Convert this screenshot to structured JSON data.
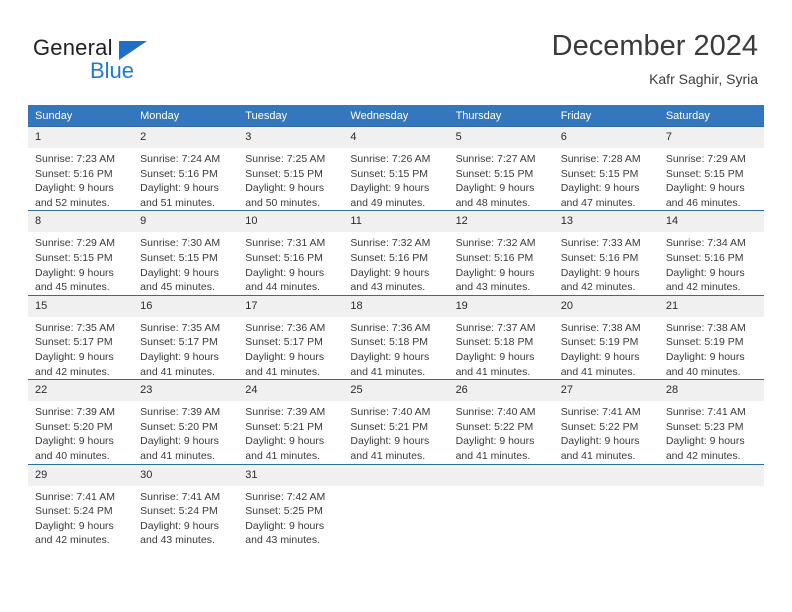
{
  "brand": {
    "name_top": "General",
    "name_bottom": "Blue",
    "accent_color": "#1f7ad4",
    "triangle_color": "#1f6fc4"
  },
  "header": {
    "month_title": "December 2024",
    "location": "Kafr Saghir, Syria"
  },
  "theme": {
    "header_row_bg": "#3577bc",
    "cell_border": "#2d6ca8",
    "daynum_bg": "#f0f0f0",
    "text": "#3a3a3a"
  },
  "weekday_headers": [
    "Sunday",
    "Monday",
    "Tuesday",
    "Wednesday",
    "Thursday",
    "Friday",
    "Saturday"
  ],
  "weeks": [
    [
      {
        "day": "1",
        "sunrise": "Sunrise: 7:23 AM",
        "sunset": "Sunset: 5:16 PM",
        "daylight_1": "Daylight: 9 hours",
        "daylight_2": "and 52 minutes."
      },
      {
        "day": "2",
        "sunrise": "Sunrise: 7:24 AM",
        "sunset": "Sunset: 5:16 PM",
        "daylight_1": "Daylight: 9 hours",
        "daylight_2": "and 51 minutes."
      },
      {
        "day": "3",
        "sunrise": "Sunrise: 7:25 AM",
        "sunset": "Sunset: 5:15 PM",
        "daylight_1": "Daylight: 9 hours",
        "daylight_2": "and 50 minutes."
      },
      {
        "day": "4",
        "sunrise": "Sunrise: 7:26 AM",
        "sunset": "Sunset: 5:15 PM",
        "daylight_1": "Daylight: 9 hours",
        "daylight_2": "and 49 minutes."
      },
      {
        "day": "5",
        "sunrise": "Sunrise: 7:27 AM",
        "sunset": "Sunset: 5:15 PM",
        "daylight_1": "Daylight: 9 hours",
        "daylight_2": "and 48 minutes."
      },
      {
        "day": "6",
        "sunrise": "Sunrise: 7:28 AM",
        "sunset": "Sunset: 5:15 PM",
        "daylight_1": "Daylight: 9 hours",
        "daylight_2": "and 47 minutes."
      },
      {
        "day": "7",
        "sunrise": "Sunrise: 7:29 AM",
        "sunset": "Sunset: 5:15 PM",
        "daylight_1": "Daylight: 9 hours",
        "daylight_2": "and 46 minutes."
      }
    ],
    [
      {
        "day": "8",
        "sunrise": "Sunrise: 7:29 AM",
        "sunset": "Sunset: 5:15 PM",
        "daylight_1": "Daylight: 9 hours",
        "daylight_2": "and 45 minutes."
      },
      {
        "day": "9",
        "sunrise": "Sunrise: 7:30 AM",
        "sunset": "Sunset: 5:15 PM",
        "daylight_1": "Daylight: 9 hours",
        "daylight_2": "and 45 minutes."
      },
      {
        "day": "10",
        "sunrise": "Sunrise: 7:31 AM",
        "sunset": "Sunset: 5:16 PM",
        "daylight_1": "Daylight: 9 hours",
        "daylight_2": "and 44 minutes."
      },
      {
        "day": "11",
        "sunrise": "Sunrise: 7:32 AM",
        "sunset": "Sunset: 5:16 PM",
        "daylight_1": "Daylight: 9 hours",
        "daylight_2": "and 43 minutes."
      },
      {
        "day": "12",
        "sunrise": "Sunrise: 7:32 AM",
        "sunset": "Sunset: 5:16 PM",
        "daylight_1": "Daylight: 9 hours",
        "daylight_2": "and 43 minutes."
      },
      {
        "day": "13",
        "sunrise": "Sunrise: 7:33 AM",
        "sunset": "Sunset: 5:16 PM",
        "daylight_1": "Daylight: 9 hours",
        "daylight_2": "and 42 minutes."
      },
      {
        "day": "14",
        "sunrise": "Sunrise: 7:34 AM",
        "sunset": "Sunset: 5:16 PM",
        "daylight_1": "Daylight: 9 hours",
        "daylight_2": "and 42 minutes."
      }
    ],
    [
      {
        "day": "15",
        "sunrise": "Sunrise: 7:35 AM",
        "sunset": "Sunset: 5:17 PM",
        "daylight_1": "Daylight: 9 hours",
        "daylight_2": "and 42 minutes."
      },
      {
        "day": "16",
        "sunrise": "Sunrise: 7:35 AM",
        "sunset": "Sunset: 5:17 PM",
        "daylight_1": "Daylight: 9 hours",
        "daylight_2": "and 41 minutes."
      },
      {
        "day": "17",
        "sunrise": "Sunrise: 7:36 AM",
        "sunset": "Sunset: 5:17 PM",
        "daylight_1": "Daylight: 9 hours",
        "daylight_2": "and 41 minutes."
      },
      {
        "day": "18",
        "sunrise": "Sunrise: 7:36 AM",
        "sunset": "Sunset: 5:18 PM",
        "daylight_1": "Daylight: 9 hours",
        "daylight_2": "and 41 minutes."
      },
      {
        "day": "19",
        "sunrise": "Sunrise: 7:37 AM",
        "sunset": "Sunset: 5:18 PM",
        "daylight_1": "Daylight: 9 hours",
        "daylight_2": "and 41 minutes."
      },
      {
        "day": "20",
        "sunrise": "Sunrise: 7:38 AM",
        "sunset": "Sunset: 5:19 PM",
        "daylight_1": "Daylight: 9 hours",
        "daylight_2": "and 41 minutes."
      },
      {
        "day": "21",
        "sunrise": "Sunrise: 7:38 AM",
        "sunset": "Sunset: 5:19 PM",
        "daylight_1": "Daylight: 9 hours",
        "daylight_2": "and 40 minutes."
      }
    ],
    [
      {
        "day": "22",
        "sunrise": "Sunrise: 7:39 AM",
        "sunset": "Sunset: 5:20 PM",
        "daylight_1": "Daylight: 9 hours",
        "daylight_2": "and 40 minutes."
      },
      {
        "day": "23",
        "sunrise": "Sunrise: 7:39 AM",
        "sunset": "Sunset: 5:20 PM",
        "daylight_1": "Daylight: 9 hours",
        "daylight_2": "and 41 minutes."
      },
      {
        "day": "24",
        "sunrise": "Sunrise: 7:39 AM",
        "sunset": "Sunset: 5:21 PM",
        "daylight_1": "Daylight: 9 hours",
        "daylight_2": "and 41 minutes."
      },
      {
        "day": "25",
        "sunrise": "Sunrise: 7:40 AM",
        "sunset": "Sunset: 5:21 PM",
        "daylight_1": "Daylight: 9 hours",
        "daylight_2": "and 41 minutes."
      },
      {
        "day": "26",
        "sunrise": "Sunrise: 7:40 AM",
        "sunset": "Sunset: 5:22 PM",
        "daylight_1": "Daylight: 9 hours",
        "daylight_2": "and 41 minutes."
      },
      {
        "day": "27",
        "sunrise": "Sunrise: 7:41 AM",
        "sunset": "Sunset: 5:22 PM",
        "daylight_1": "Daylight: 9 hours",
        "daylight_2": "and 41 minutes."
      },
      {
        "day": "28",
        "sunrise": "Sunrise: 7:41 AM",
        "sunset": "Sunset: 5:23 PM",
        "daylight_1": "Daylight: 9 hours",
        "daylight_2": "and 42 minutes."
      }
    ],
    [
      {
        "day": "29",
        "sunrise": "Sunrise: 7:41 AM",
        "sunset": "Sunset: 5:24 PM",
        "daylight_1": "Daylight: 9 hours",
        "daylight_2": "and 42 minutes."
      },
      {
        "day": "30",
        "sunrise": "Sunrise: 7:41 AM",
        "sunset": "Sunset: 5:24 PM",
        "daylight_1": "Daylight: 9 hours",
        "daylight_2": "and 43 minutes."
      },
      {
        "day": "31",
        "sunrise": "Sunrise: 7:42 AM",
        "sunset": "Sunset: 5:25 PM",
        "daylight_1": "Daylight: 9 hours",
        "daylight_2": "and 43 minutes."
      },
      {
        "day": "",
        "sunrise": "",
        "sunset": "",
        "daylight_1": "",
        "daylight_2": ""
      },
      {
        "day": "",
        "sunrise": "",
        "sunset": "",
        "daylight_1": "",
        "daylight_2": ""
      },
      {
        "day": "",
        "sunrise": "",
        "sunset": "",
        "daylight_1": "",
        "daylight_2": ""
      },
      {
        "day": "",
        "sunrise": "",
        "sunset": "",
        "daylight_1": "",
        "daylight_2": ""
      }
    ]
  ]
}
